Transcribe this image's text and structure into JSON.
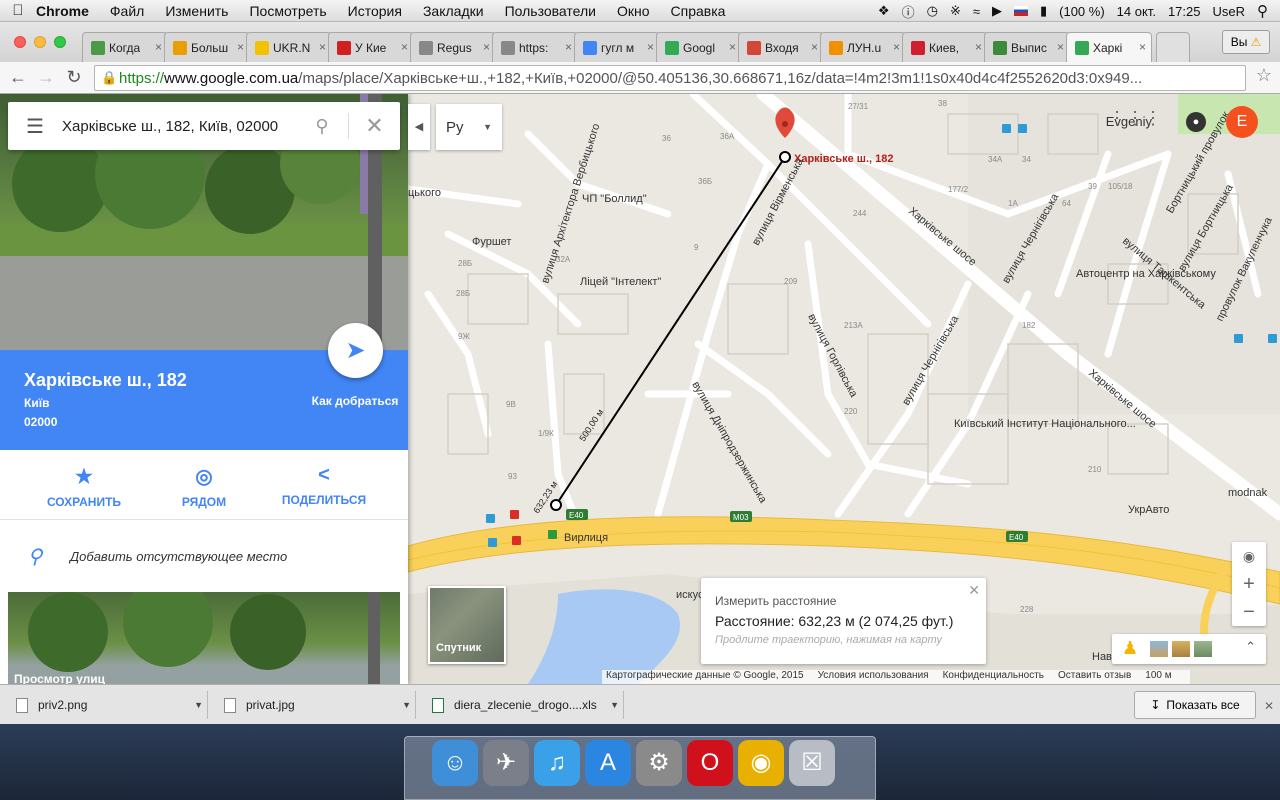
{
  "menubar": {
    "app": "Chrome",
    "items": [
      "Файл",
      "Изменить",
      "Посмотреть",
      "История",
      "Закладки",
      "Пользователи",
      "Окно",
      "Справка"
    ],
    "battery": "(100 %)",
    "date": "14 окт.",
    "time": "17:25",
    "user": "UseR"
  },
  "tabs": [
    {
      "label": "Когда",
      "color": "#4a9a4a"
    },
    {
      "label": "Больш",
      "color": "#e8a000"
    },
    {
      "label": "UKR.N",
      "color": "#f2c200"
    },
    {
      "label": "У Кие",
      "color": "#d02020"
    },
    {
      "label": "Regus",
      "color": "#888888"
    },
    {
      "label": "https:",
      "color": "#888888"
    },
    {
      "label": "гугл м",
      "color": "#4285f4"
    },
    {
      "label": "Googl",
      "color": "#34a853"
    },
    {
      "label": "Входя",
      "color": "#d44638"
    },
    {
      "label": "ЛУН.u",
      "color": "#f29100"
    },
    {
      "label": "Киев,",
      "color": "#d02030"
    },
    {
      "label": "Выпис",
      "color": "#3c8b3c"
    },
    {
      "label": "Харкі",
      "color": "#34a853"
    }
  ],
  "profile_button": "Вы",
  "url": {
    "scheme": "https://",
    "host": "www.google.com.ua",
    "path": "/maps/place/Харківське+ш.,+182,+Київ,+02000/@50.405136,30.668671,16z/data=!4m2!3m1!1s0x40d4c4f2552620d3:0x949..."
  },
  "search": {
    "query": "Харківське ш., 182, Київ, 02000"
  },
  "place": {
    "title": "Харківське ш., 182",
    "city": "Київ",
    "zip": "02000",
    "directions_label": "Как добраться"
  },
  "actions": {
    "save": "СОХРАНИТЬ",
    "nearby": "РЯДОМ",
    "share": "ПОДЕЛИТЬСЯ"
  },
  "add_place": "Добавить отсутствующее место",
  "street_view_caption": "Просмотр улиц",
  "lang": "Ру",
  "map": {
    "user_name": "Evgeniy",
    "avatar_letter": "E",
    "pin_label": "Харківське ш., 182",
    "satellite_label": "Спутник",
    "labels": [
      {
        "t": "вулиця Архітектора Вербицького"
      },
      {
        "t": "ЧП \"Боллид\""
      },
      {
        "t": "Фуршет"
      },
      {
        "t": "Ліцей \"Інтелект\""
      },
      {
        "t": "вулиця Вірменська"
      },
      {
        "t": "вулиця Горлівська"
      },
      {
        "t": "вулиця Дніпродзержинська"
      },
      {
        "t": "Харківське шосе"
      },
      {
        "t": "Харківське шосе"
      },
      {
        "t": "вулиця Чернігівська"
      },
      {
        "t": "вулиця Чернігівська"
      },
      {
        "t": "Автоцентр на Харківському"
      },
      {
        "t": "Київський Інститут Національного..."
      },
      {
        "t": "вулиця Ташкентська"
      },
      {
        "t": "Бортницький провулок"
      },
      {
        "t": "вулиця Бортницька"
      },
      {
        "t": "провулок Вакуленчука"
      },
      {
        "t": "УкрАвто"
      },
      {
        "t": "Вирлиця"
      },
      {
        "t": "Навчальн інститут підготовки"
      },
      {
        "t": "modnak"
      },
      {
        "t": "цького"
      },
      {
        "t": "искус"
      }
    ],
    "road_badges": [
      "E40",
      "M03",
      "E40"
    ],
    "segment_labels": [
      "632,23 м",
      "500,00 м"
    ]
  },
  "measure": {
    "title": "Измерить расстояние",
    "distance": "Расстояние: 632,23 м (2 074,25 фут.)",
    "hint": "Продлите траекторию, нажимая на карту"
  },
  "attribution": {
    "data": "Картографические данные © Google, 2015",
    "terms": "Условия использования",
    "privacy": "Конфиденциальность",
    "feedback": "Оставить отзыв",
    "scale": "100 м"
  },
  "downloads": {
    "items": [
      "priv2.png",
      "privat.jpg",
      "diera_zlecenie_drogo....xls"
    ],
    "show_all": "Показать все"
  },
  "dock": [
    {
      "name": "finder-icon",
      "color": "#3f8fd8"
    },
    {
      "name": "launchpad-icon",
      "color": "#7a7f8a"
    },
    {
      "name": "itunes-icon",
      "color": "#3aa0e8"
    },
    {
      "name": "app-store-icon",
      "color": "#2a86e0"
    },
    {
      "name": "system-preferences-icon",
      "color": "#8a8a8a"
    },
    {
      "name": "opera-icon",
      "color": "#d0101a"
    },
    {
      "name": "chrome-icon",
      "color": "#e8b000"
    },
    {
      "name": "trash-icon",
      "color": "#b8bcc4"
    }
  ]
}
